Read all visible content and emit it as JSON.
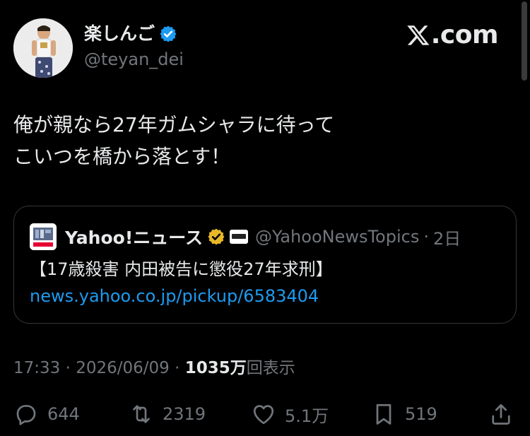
{
  "author": {
    "display_name": "楽しんご",
    "handle": "@teyan_dei",
    "verified_color": "#1d9bf0"
  },
  "brand": {
    "text": ".com"
  },
  "tweet": {
    "lines": [
      "俺が親なら27年ガムシャラに待って",
      "こいつを橋から落とす！"
    ]
  },
  "quote": {
    "name": "Yahoo!ニュース",
    "handle": "@YahooNewsTopics",
    "separator": "·",
    "time": "2日",
    "title": "【17歳殺害 内田被告に懲役27年求刑】",
    "link": "news.yahoo.co.jp/pickup/6583404",
    "link_color": "#1d9bf0"
  },
  "meta": {
    "time": "17:33",
    "separator": "·",
    "date": "2026/06/09",
    "views_count": "1035万",
    "views_label": "回表示"
  },
  "actions": {
    "reply_count": "644",
    "retweet_count": "2319",
    "like_count": "5.1万",
    "bookmark_count": "519"
  }
}
